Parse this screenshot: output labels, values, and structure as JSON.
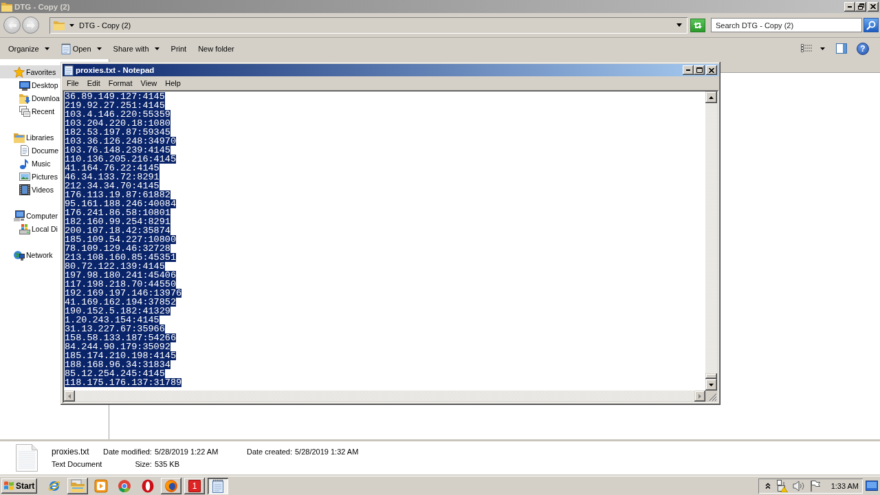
{
  "explorer": {
    "title": "DTG - Copy (2)",
    "nav_buttons": [
      {
        "kind": "back",
        "disabled": true
      },
      {
        "kind": "forward",
        "disabled": true
      }
    ],
    "address": "DTG - Copy (2)",
    "search": {
      "placeholder": "Search DTG - Copy (2)"
    },
    "toolbar": [
      {
        "label": "Organize",
        "kind": "menu"
      },
      {
        "label": "Open",
        "kind": "split"
      },
      {
        "label": "Share with",
        "kind": "menu"
      },
      {
        "label": "Print",
        "kind": "plain"
      },
      {
        "label": "New folder",
        "kind": "plain"
      }
    ],
    "help": "?",
    "sidebar": [
      {
        "label": "Favorites",
        "kind": "favorites",
        "selected": true,
        "children": [
          {
            "label": "Desktop",
            "kind": "desktop",
            "selected": false
          },
          {
            "label": "Downloa",
            "kind": "downloads",
            "selected": false
          },
          {
            "label": "Recent",
            "kind": "recent",
            "selected": false
          }
        ]
      },
      {
        "label": "Libraries",
        "kind": "libraries",
        "selected": false,
        "children": [
          {
            "label": "Docume",
            "kind": "documents",
            "selected": false
          },
          {
            "label": "Music",
            "kind": "music",
            "selected": false
          },
          {
            "label": "Pictures",
            "kind": "pictures",
            "selected": false
          },
          {
            "label": "Videos",
            "kind": "videos",
            "selected": false
          }
        ]
      },
      {
        "label": "Computer",
        "kind": "computer",
        "selected": false,
        "children": [
          {
            "label": "Local Di",
            "kind": "disk",
            "selected": false
          }
        ]
      },
      {
        "label": "Network",
        "kind": "network",
        "selected": false
      }
    ],
    "details": {
      "file_name": "proxies.txt",
      "file_type": "Text Document",
      "fields": [
        {
          "label": "Date modified:",
          "value": "5/28/2019 1:22 AM"
        },
        {
          "label": "Size:",
          "value": "535 KB"
        },
        {
          "label": "Date created:",
          "value": "5/28/2019 1:32 AM"
        }
      ]
    }
  },
  "notepad": {
    "title": "proxies.txt - Notepad",
    "menu": [
      "File",
      "Edit",
      "Format",
      "View",
      "Help"
    ],
    "selected": true,
    "lines": [
      "36.89.149.127:4145",
      "219.92.27.251:4145",
      "103.4.146.220:55359",
      "103.204.220.18:1080",
      "182.53.197.87:59345",
      "103.36.126.248:34970",
      "103.76.148.239:4145",
      "110.136.205.216:4145",
      "41.164.76.22:4145",
      "46.34.133.72:8291",
      "212.34.34.70:4145",
      "176.113.19.87:61882",
      "95.161.188.246:40084",
      "176.241.86.58:10801",
      "182.160.99.254:8291",
      "200.107.18.42:35874",
      "185.109.54.227:10800",
      "78.109.129.46:32728",
      "213.108.160.85:45351",
      "80.72.122.139:4145",
      "197.98.180.241:45406",
      "117.198.218.70:44550",
      "192.169.197.146:13976",
      "41.169.162.194:37852",
      "190.152.5.182:41329",
      "1.20.243.154:4145",
      "31.13.227.67:35966",
      "158.58.133.187:54266",
      "84.244.90.179:35092",
      "185.174.210.198:4145",
      "188.168.96.34:31834",
      "85.12.254.245:4145",
      "118.175.176.137:31789"
    ]
  },
  "taskbar": {
    "start": "Start",
    "apps": [
      {
        "kind": "ie",
        "running": false
      },
      {
        "kind": "explorer",
        "running": true,
        "active": false
      },
      {
        "kind": "media",
        "running": false
      },
      {
        "kind": "chrome",
        "running": false
      },
      {
        "kind": "opera",
        "running": false
      },
      {
        "kind": "firefox",
        "running": true,
        "active": false
      },
      {
        "kind": "badge",
        "label": "1",
        "running": true,
        "active": false
      },
      {
        "kind": "notepad",
        "running": true,
        "active": true
      }
    ],
    "clock": "1:33 AM"
  }
}
